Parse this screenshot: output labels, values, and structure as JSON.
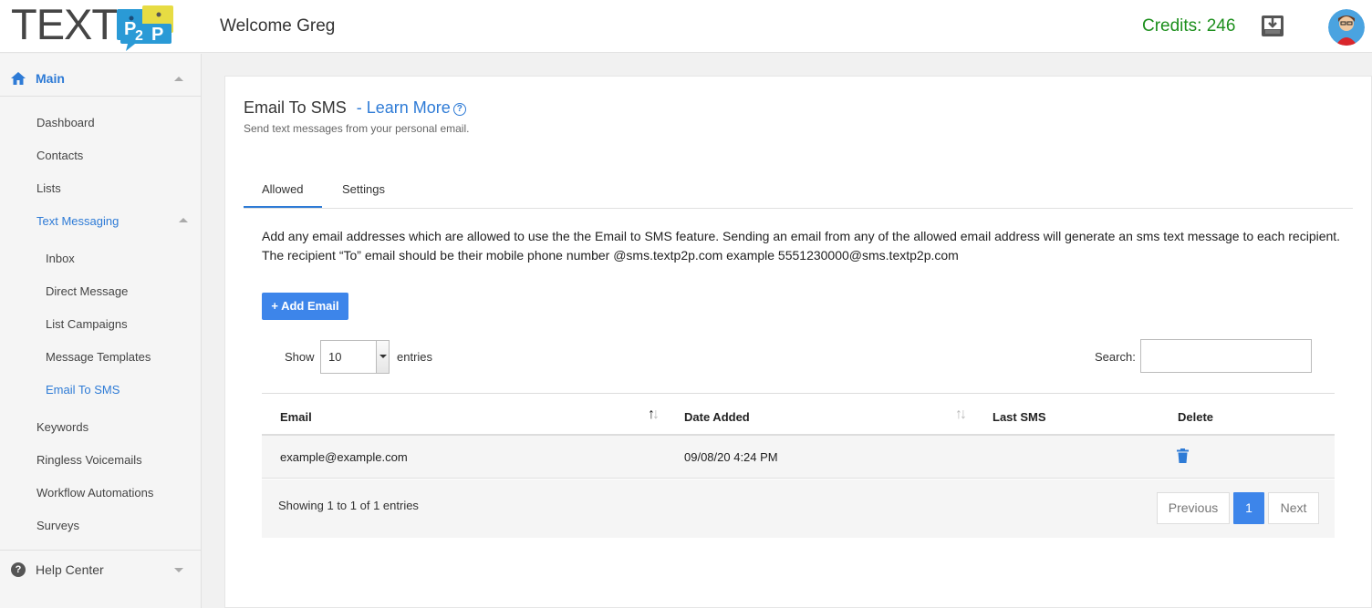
{
  "header": {
    "logo_text": "TEXT",
    "welcome": "Welcome Greg",
    "credits": "Credits: 246"
  },
  "sidebar": {
    "main_label": "Main",
    "items": [
      "Dashboard",
      "Contacts",
      "Lists"
    ],
    "text_messaging_label": "Text Messaging",
    "sub_items": [
      "Inbox",
      "Direct Message",
      "List Campaigns",
      "Message Templates",
      "Email To SMS"
    ],
    "more_items": [
      "Keywords",
      "Ringless Voicemails",
      "Workflow Automations",
      "Surveys"
    ],
    "help_label": "Help Center"
  },
  "page": {
    "title": "Email To SMS",
    "learn_more": "- Learn More",
    "subtitle": "Send text messages from your personal email.",
    "tabs": [
      "Allowed",
      "Settings"
    ],
    "description": "Add any email addresses which are allowed to use the the Email to SMS feature. Sending an email from any of the allowed email address will generate an sms text message to each recipient. The recipient “To” email should be their mobile phone number @sms.textp2p.com example 5551230000@sms.textp2p.com",
    "add_button": "+ Add Email"
  },
  "table": {
    "show_label": "Show",
    "page_size": "10",
    "entries_label": "entries",
    "search_label": "Search:",
    "search_value": "",
    "columns": [
      "Email",
      "Date Added",
      "Last SMS",
      "Delete"
    ],
    "rows": [
      {
        "email": "example@example.com",
        "date_added": "09/08/20 4:24 PM",
        "last_sms": ""
      }
    ],
    "info": "Showing 1 to 1 of 1 entries",
    "prev_label": "Previous",
    "current_page": "1",
    "next_label": "Next"
  },
  "colors": {
    "accent": "#3d85ea",
    "link": "#2e7bd6",
    "credits": "#1c8f1c"
  }
}
